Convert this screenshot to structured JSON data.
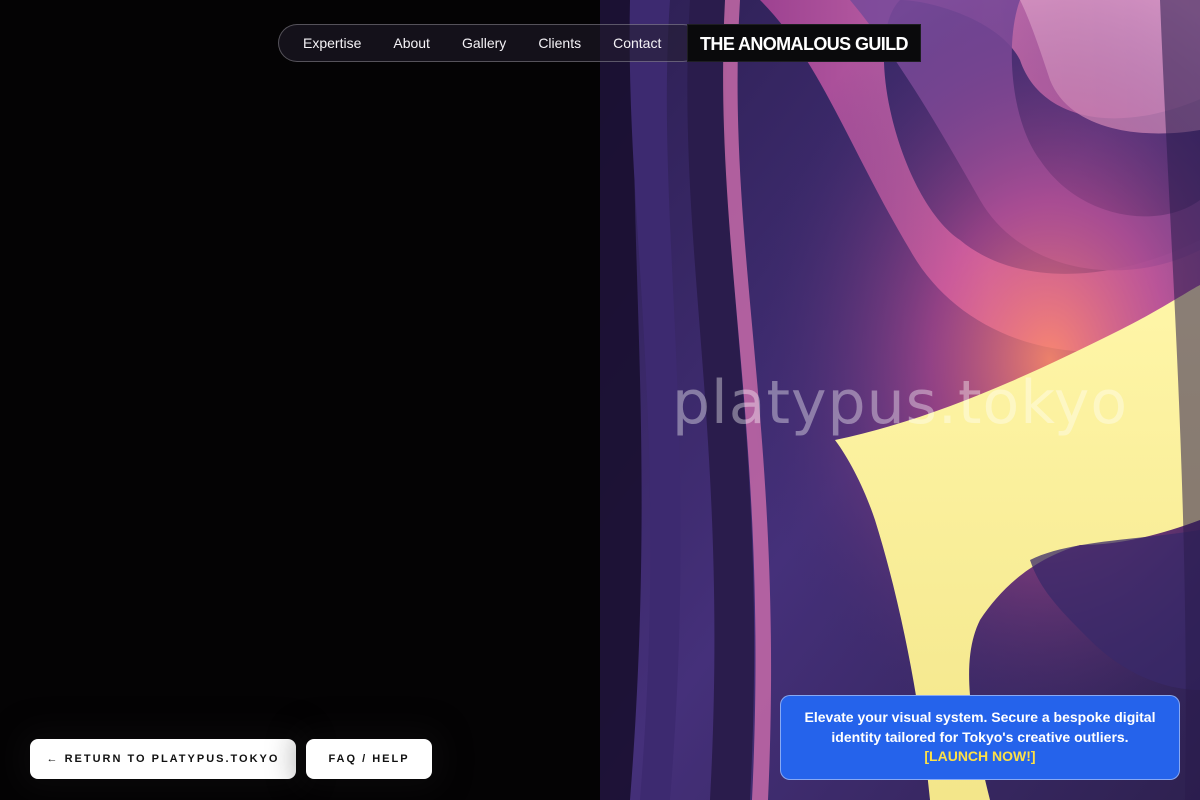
{
  "nav": {
    "items": [
      "Expertise",
      "About",
      "Gallery",
      "Clients",
      "Contact"
    ],
    "brand": "THE ANOMALOUS GUILD"
  },
  "hero": {
    "watermark": "platypus.tokyo"
  },
  "footer": {
    "return_label": "← RETURN TO PLATYPUS.TOKYO",
    "faq_label": "FAQ / HELP"
  },
  "promo": {
    "text": "Elevate your visual system. Secure a bespoke digital identity tailored for Tokyo's creative outliers.",
    "cta": "[LAUNCH NOW!]"
  },
  "colors": {
    "background": "#040304",
    "promo_bg": "#2563eb",
    "promo_cta": "#fde047",
    "art_purple": "#4a3580",
    "art_pink": "#e05aa8",
    "art_yellow": "#f7ef9a"
  },
  "icons": {
    "return_arrow": "arrow-left-icon"
  }
}
